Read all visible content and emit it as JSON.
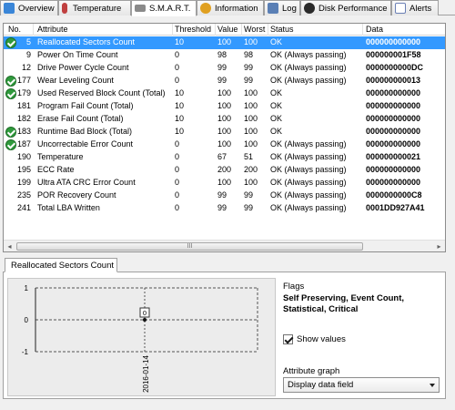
{
  "tabs": [
    {
      "label": "Overview",
      "icon": "overview-icon",
      "color": "#3a86d8"
    },
    {
      "label": "Temperature",
      "icon": "thermometer-icon",
      "color": "#c04040"
    },
    {
      "label": "S.M.A.R.T.",
      "icon": "smart-icon",
      "color": "#6a6a6a"
    },
    {
      "label": "Information",
      "icon": "info-icon",
      "color": "#e0a020"
    },
    {
      "label": "Log",
      "icon": "log-icon",
      "color": "#5a7fb5"
    },
    {
      "label": "Disk Performance",
      "icon": "disk-performance-icon",
      "color": "#2a2a2a"
    },
    {
      "label": "Alerts",
      "icon": "alerts-icon",
      "color": "#6a7fb5"
    }
  ],
  "table": {
    "headers": {
      "no": "No.",
      "attribute": "Attribute",
      "threshold": "Threshold",
      "value": "Value",
      "worst": "Worst",
      "status": "Status",
      "data": "Data"
    },
    "rows": [
      {
        "ok": true,
        "no": "5",
        "attribute": "Reallocated Sectors Count",
        "threshold": "10",
        "value": "100",
        "worst": "100",
        "status": "OK",
        "data": "000000000000",
        "selected": true
      },
      {
        "ok": false,
        "no": "9",
        "attribute": "Power On Time Count",
        "threshold": "0",
        "value": "98",
        "worst": "98",
        "status": "OK (Always passing)",
        "data": "000000001F58"
      },
      {
        "ok": false,
        "no": "12",
        "attribute": "Drive Power Cycle Count",
        "threshold": "0",
        "value": "99",
        "worst": "99",
        "status": "OK (Always passing)",
        "data": "0000000000DC"
      },
      {
        "ok": true,
        "no": "177",
        "attribute": "Wear Leveling Count",
        "threshold": "0",
        "value": "99",
        "worst": "99",
        "status": "OK (Always passing)",
        "data": "000000000013"
      },
      {
        "ok": true,
        "no": "179",
        "attribute": "Used Reserved Block Count (Total)",
        "threshold": "10",
        "value": "100",
        "worst": "100",
        "status": "OK",
        "data": "000000000000"
      },
      {
        "ok": false,
        "no": "181",
        "attribute": "Program Fail Count (Total)",
        "threshold": "10",
        "value": "100",
        "worst": "100",
        "status": "OK",
        "data": "000000000000"
      },
      {
        "ok": false,
        "no": "182",
        "attribute": "Erase Fail Count (Total)",
        "threshold": "10",
        "value": "100",
        "worst": "100",
        "status": "OK",
        "data": "000000000000"
      },
      {
        "ok": true,
        "no": "183",
        "attribute": "Runtime Bad Block (Total)",
        "threshold": "10",
        "value": "100",
        "worst": "100",
        "status": "OK",
        "data": "000000000000"
      },
      {
        "ok": true,
        "no": "187",
        "attribute": "Uncorrectable Error Count",
        "threshold": "0",
        "value": "100",
        "worst": "100",
        "status": "OK (Always passing)",
        "data": "000000000000"
      },
      {
        "ok": false,
        "no": "190",
        "attribute": "Temperature",
        "threshold": "0",
        "value": "67",
        "worst": "51",
        "status": "OK (Always passing)",
        "data": "000000000021"
      },
      {
        "ok": false,
        "no": "195",
        "attribute": "ECC Rate",
        "threshold": "0",
        "value": "200",
        "worst": "200",
        "status": "OK (Always passing)",
        "data": "000000000000"
      },
      {
        "ok": false,
        "no": "199",
        "attribute": "Ultra ATA CRC Error Count",
        "threshold": "0",
        "value": "100",
        "worst": "100",
        "status": "OK (Always passing)",
        "data": "000000000000"
      },
      {
        "ok": false,
        "no": "235",
        "attribute": "POR Recovery Count",
        "threshold": "0",
        "value": "99",
        "worst": "99",
        "status": "OK (Always passing)",
        "data": "0000000000C8"
      },
      {
        "ok": false,
        "no": "241",
        "attribute": "Total LBA Written",
        "threshold": "0",
        "value": "99",
        "worst": "99",
        "status": "OK (Always passing)",
        "data": "0001DD927A41"
      }
    ]
  },
  "scrollbar": {
    "left_arrow": "◂",
    "right_arrow": "▸",
    "grip": "III"
  },
  "detail": {
    "tab_label": "Reallocated Sectors Count",
    "flags_title": "Flags",
    "flags_value": "Self Preserving, Event Count, Statistical, Critical",
    "show_values_label": "Show values",
    "show_values_checked": true,
    "attribute_graph_label": "Attribute graph",
    "attribute_graph_selected": "Display data field",
    "graph": {
      "y_ticks": [
        "1",
        "0",
        "-1"
      ],
      "x_label": "2016-01-14",
      "point_value": "0"
    }
  },
  "colors": {
    "ok_check": "#2f9a3c",
    "selection": "#3399ff"
  }
}
